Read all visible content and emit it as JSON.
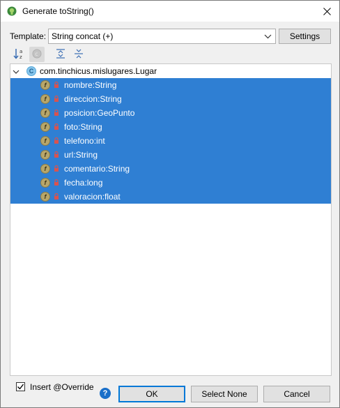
{
  "window": {
    "title": "Generate toString()"
  },
  "template": {
    "label": "Template:",
    "selected": "String concat (+)",
    "settings_label": "Settings"
  },
  "toolbar": {
    "items": [
      {
        "name": "sort-alphabetically-icon"
      },
      {
        "name": "show-classes-icon",
        "disabled": true
      },
      {
        "name": "expand-all-icon"
      },
      {
        "name": "collapse-all-icon"
      }
    ]
  },
  "tree": {
    "root": {
      "icon": "C",
      "label": "com.tinchicus.mislugares.Lugar"
    },
    "fields": [
      {
        "icon": "f",
        "label": "nombre:String"
      },
      {
        "icon": "f",
        "label": "direccion:String"
      },
      {
        "icon": "f",
        "label": "posicion:GeoPunto"
      },
      {
        "icon": "f",
        "label": "foto:String"
      },
      {
        "icon": "f",
        "label": "telefono:int"
      },
      {
        "icon": "f",
        "label": "url:String"
      },
      {
        "icon": "f",
        "label": "comentario:String"
      },
      {
        "icon": "f",
        "label": "fecha:long"
      },
      {
        "icon": "f",
        "label": "valoracion:float"
      }
    ]
  },
  "footer": {
    "override_checked": true,
    "override_label": "Insert @Override",
    "help_label": "?",
    "ok_label": "OK",
    "select_none_label": "Select None",
    "cancel_label": "Cancel"
  },
  "colors": {
    "selection": "#2f7fd3",
    "field_icon": "#b7a66a",
    "lock": "#d9534f",
    "accent": "#0078d7"
  }
}
